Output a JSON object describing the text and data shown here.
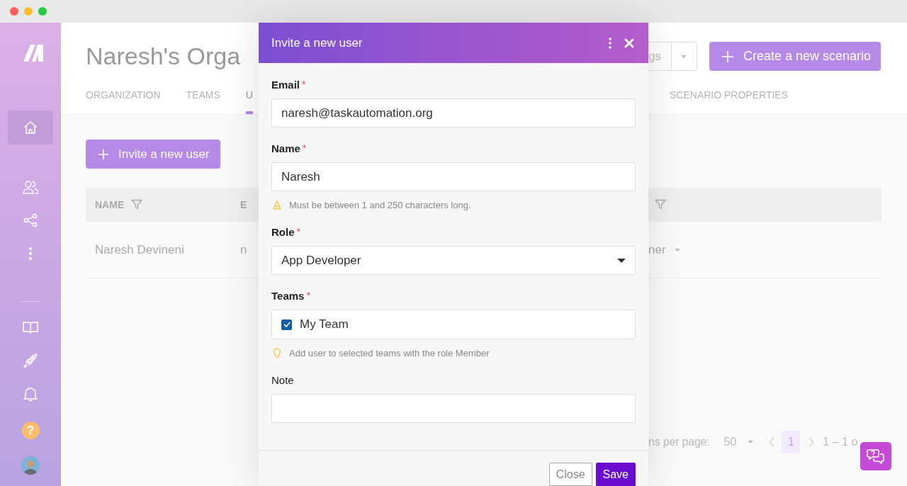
{
  "sidebar": {
    "items": [
      {
        "kind": "home",
        "selected": true
      },
      {
        "kind": "users",
        "selected": false
      },
      {
        "kind": "share",
        "selected": false
      },
      {
        "kind": "more",
        "selected": false
      },
      {
        "kind": "book",
        "selected": false
      },
      {
        "kind": "rocket",
        "selected": false
      },
      {
        "kind": "bell",
        "selected": false
      }
    ],
    "help": "?"
  },
  "header": {
    "title": "Naresh's Orga",
    "settings_button": "gs",
    "create_button": "Create a new scenario"
  },
  "tabs": [
    {
      "label": "ORGANIZATION",
      "selected": false
    },
    {
      "label": "TEAMS",
      "selected": false
    },
    {
      "label": "U",
      "selected": true
    },
    {
      "label": "SCENARIO PROPERTIES",
      "selected": false
    }
  ],
  "invite_button": "Invite a new user",
  "table": {
    "columns": [
      {
        "label": "NAME",
        "filter": true
      },
      {
        "label": "E",
        "filter": false
      },
      {
        "filter": true
      }
    ],
    "rows": [
      {
        "cells": [
          "Naresh Devineni",
          "n",
          "ner"
        ]
      }
    ]
  },
  "pagination": {
    "per_page_label": "ns per page:",
    "per_page": "50",
    "page": "1",
    "range": "1 – 1 o"
  },
  "modal": {
    "title": "Invite a new user",
    "fields": [
      {
        "kind": "text",
        "label": "Email",
        "required_mark": "*",
        "value": "naresh@taskautomation.org"
      },
      {
        "kind": "text",
        "label": "Name",
        "required_mark": "*",
        "value": "Naresh",
        "hint": {
          "text": "Must be between 1 and 250 characters long.",
          "kind": "warning"
        }
      },
      {
        "kind": "select",
        "label": "Role",
        "required_mark": "*",
        "value": "App Developer"
      },
      {
        "kind": "checklist",
        "label": "Teams",
        "required_mark": "*",
        "options": [
          {
            "label": "My Team",
            "checked": true
          }
        ],
        "hint": {
          "text": "Add user to selected teams with the role Member",
          "kind": "tip"
        }
      },
      {
        "kind": "textarea",
        "label": "Note"
      }
    ],
    "buttons": [
      {
        "label": "Close",
        "primary": false
      },
      {
        "label": "Save",
        "primary": true
      }
    ]
  }
}
